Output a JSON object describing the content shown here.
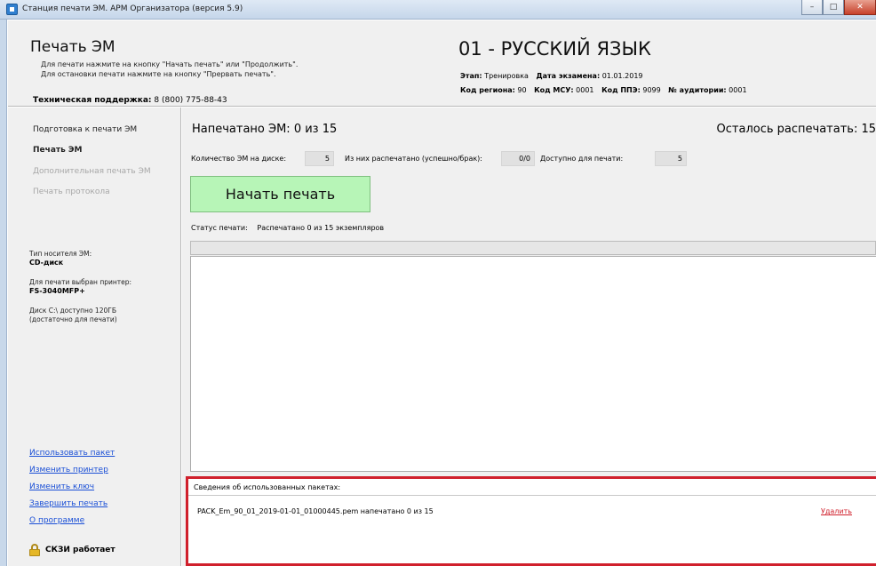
{
  "window": {
    "title": "Станция печати ЭМ. АРМ Организатора (версия 5.9)",
    "min_glyph": "–",
    "max_glyph": "□",
    "close_glyph": "✕"
  },
  "header": {
    "title": "Печать ЭМ",
    "hint1": "Для печати нажмите на кнопку \"Начать печать\" или \"Продолжить\".",
    "hint2": "Для остановки печати нажмите на кнопку \"Прервать печать\".",
    "support_label": "Техническая поддержка:",
    "support_phone": "8 (800) 775-88-43",
    "subject": "01 - РУССКИЙ ЯЗЫК",
    "stage_label": "Этап:",
    "stage_value": "Тренировка",
    "exam_date_label": "Дата экзамена:",
    "exam_date_value": "01.01.2019",
    "region_label": "Код региона:",
    "region_value": "90",
    "msu_label": "Код МСУ:",
    "msu_value": "0001",
    "ppe_label": "Код ППЭ:",
    "ppe_value": "9099",
    "room_label": "№ аудитории:",
    "room_value": "0001"
  },
  "sidebar": {
    "nav": [
      {
        "label": "Подготовка к печати ЭМ",
        "state": "normal"
      },
      {
        "label": "Печать ЭМ",
        "state": "active"
      },
      {
        "label": "Дополнительная печать ЭМ",
        "state": "disabled"
      },
      {
        "label": "Печать протокола",
        "state": "disabled"
      }
    ],
    "media_label": "Тип носителя ЭМ:",
    "media_value": "CD-диск",
    "printer_label": "Для печати выбран принтер:",
    "printer_value": "FS-3040MFP+",
    "disk_line1": "Диск C:\\ доступно 120ГБ",
    "disk_line2": "(достаточно для печати)",
    "links": [
      "Использовать пакет",
      "Изменить принтер",
      "Изменить ключ",
      "Завершить печать",
      "О программе"
    ],
    "skzi_status": "СКЗИ работает"
  },
  "main": {
    "printed_text": "Напечатано ЭМ: 0 из 15",
    "remaining_text": "Осталось распечатать: 15",
    "disk_count_label": "Количество ЭМ на диске:",
    "disk_count_value": "5",
    "printed_ratio_label": "Из них распечатано (успешно/брак):",
    "printed_ratio_value": "0/0",
    "available_label": "Доступно для печати:",
    "available_value": "5",
    "start_button": "Начать печать",
    "status_label": "Статус печати:",
    "status_value": "Распечатано 0 из 15 экземпляров",
    "progress_fraction": 0,
    "packets_header": "Сведения об использованных пакетах:",
    "packet_name": "PACK_Em_90_01_2019-01-01_01000445.pem напечатано 0 из 15",
    "packet_delete": "Удалить"
  }
}
